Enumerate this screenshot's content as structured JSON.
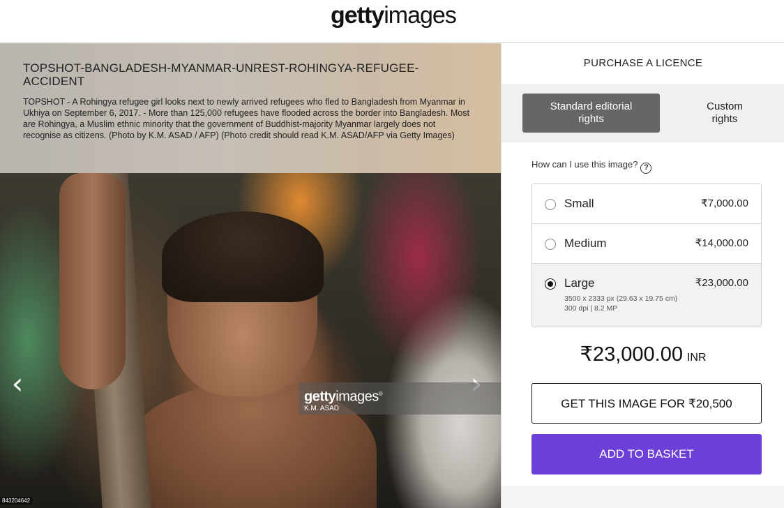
{
  "header": {
    "logo_bold": "getty",
    "logo_light": "images"
  },
  "caption": {
    "title": "TOPSHOT-BANGLADESH-MYANMAR-UNREST-ROHINGYA-REFUGEE-ACCIDENT",
    "text": "TOPSHOT - A Rohingya refugee girl looks next to newly arrived refugees who fled to Bangladesh from Myanmar in Ukhiya on September 6, 2017. - More than 125,000 refugees have flooded across the border into Bangladesh. Most are Rohingya, a Muslim ethnic minority that the government of Buddhist-majority Myanmar largely does not recognise as citizens. (Photo by K.M. ASAD / AFP) (Photo credit should read K.M. ASAD/AFP via Getty Images)"
  },
  "image": {
    "watermark_bold": "getty",
    "watermark_light": "images",
    "watermark_mark": "®",
    "credit": "K.M. ASAD",
    "image_id": "843204642",
    "prev_glyph": "‹",
    "next_glyph": "›"
  },
  "panel": {
    "title": "PURCHASE A LICENCE",
    "tabs": [
      {
        "label_line1": "Standard editorial",
        "label_line2": "rights",
        "active": true
      },
      {
        "label_line1": "Custom",
        "label_line2": "rights",
        "active": false
      }
    ],
    "use_question": "How can I use this image?",
    "help_glyph": "?",
    "sizes": [
      {
        "name": "Small",
        "price": "₹7,000.00",
        "selected": false
      },
      {
        "name": "Medium",
        "price": "₹14,000.00",
        "selected": false
      },
      {
        "name": "Large",
        "price": "₹23,000.00",
        "selected": true,
        "detail_line1": "3500 x 2333 px (29.63 x 19.75 cm)",
        "detail_line2": "300 dpi | 8.2 MP"
      }
    ],
    "total_amount": "₹23,000.00",
    "total_currency": "INR",
    "get_button": "GET THIS IMAGE FOR ₹20,500",
    "basket_button": "ADD TO BASKET"
  },
  "colors": {
    "accent": "#6c3fd6",
    "tab_active": "#666666"
  }
}
